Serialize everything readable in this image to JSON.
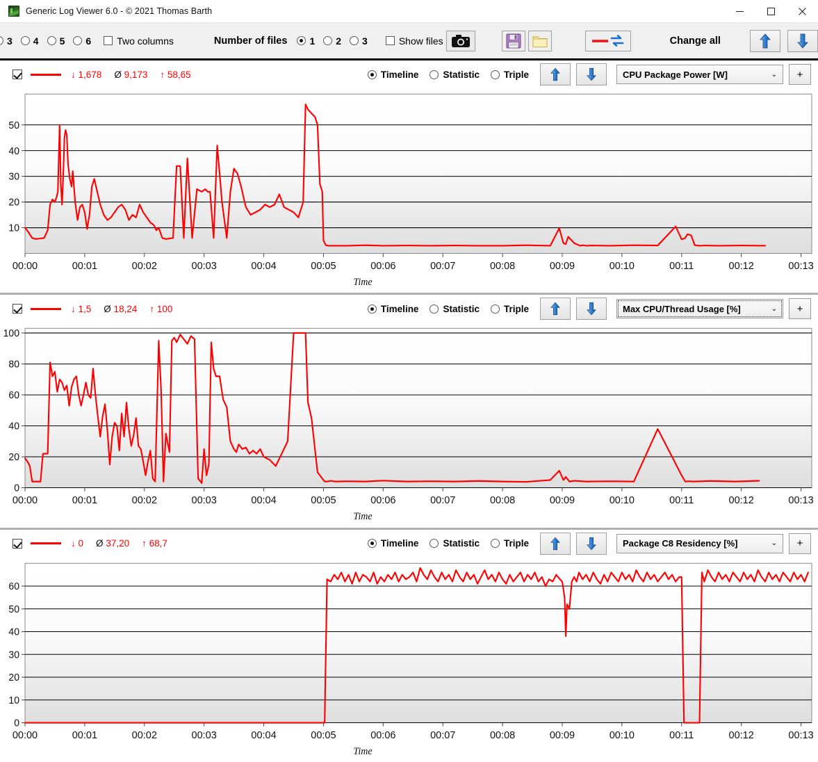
{
  "window": {
    "title": "Generic Log Viewer 6.0 - © 2021 Thomas Barth",
    "app_icon": "app-icon",
    "minimize": "–",
    "maximize": "□",
    "close": "✕"
  },
  "toolbar": {
    "columns_radios": [
      {
        "label": "3",
        "selected": false
      },
      {
        "label": "4",
        "selected": false
      },
      {
        "label": "5",
        "selected": false
      },
      {
        "label": "6",
        "selected": false
      }
    ],
    "two_columns_label": "Two columns",
    "two_columns_checked": false,
    "number_of_files_label": "Number of files",
    "file_radios": [
      {
        "label": "1",
        "selected": true
      },
      {
        "label": "2",
        "selected": false
      },
      {
        "label": "3",
        "selected": false
      }
    ],
    "show_files_label": "Show files",
    "show_files_checked": false,
    "camera_button": "camera-icon",
    "save_button": "floppy-disk-icon",
    "open_button": "folder-icon",
    "swap_button": "line-swap-icon",
    "change_all_label": "Change all",
    "move_up_button": "arrow-up-icon",
    "move_down_button": "arrow-down-icon"
  },
  "common": {
    "mode_timeline": "Timeline",
    "mode_statistic": "Statistic",
    "mode_triple": "Triple",
    "min_symbol": "↓",
    "avg_symbol": "Ø",
    "max_symbol": "↑",
    "plus_label": "+",
    "caret": "⌄",
    "xlabel": "Time"
  },
  "charts": [
    {
      "enabled": true,
      "min": "1,678",
      "avg": "9,173",
      "max": "58,65",
      "mode": "Timeline",
      "metric": "CPU Package Power [W]",
      "focused": false
    },
    {
      "enabled": true,
      "min": "1,5",
      "avg": "18,24",
      "max": "100",
      "mode": "Timeline",
      "metric": "Max CPU/Thread Usage [%]",
      "focused": true
    },
    {
      "enabled": true,
      "min": "0",
      "avg": "37,20",
      "max": "68,7",
      "mode": "Timeline",
      "metric": "Package C8 Residency [%]",
      "focused": false
    }
  ],
  "chart_data": [
    {
      "type": "line",
      "title": "CPU Package Power [W]",
      "xlabel": "Time",
      "ylabel": "",
      "series_color": "#ff0000",
      "grid": true,
      "legend": "none",
      "xlim": [
        0,
        13.18
      ],
      "ylim": [
        0,
        62
      ],
      "xticks": [
        "00:00",
        "00:01",
        "00:02",
        "00:03",
        "00:04",
        "00:05",
        "00:06",
        "00:07",
        "00:08",
        "00:09",
        "00:10",
        "00:11",
        "00:12",
        "00:13"
      ],
      "yticks": [
        10,
        20,
        30,
        40,
        50
      ],
      "x": [
        0,
        0.05,
        0.12,
        0.18,
        0.25,
        0.32,
        0.38,
        0.42,
        0.46,
        0.5,
        0.53,
        0.55,
        0.58,
        0.6,
        0.62,
        0.64,
        0.66,
        0.68,
        0.7,
        0.72,
        0.75,
        0.78,
        0.8,
        0.84,
        0.88,
        0.92,
        0.96,
        1.0,
        1.04,
        1.08,
        1.12,
        1.16,
        1.2,
        1.26,
        1.32,
        1.38,
        1.44,
        1.5,
        1.56,
        1.62,
        1.68,
        1.74,
        1.8,
        1.86,
        1.92,
        1.98,
        2.04,
        2.1,
        2.16,
        2.2,
        2.24,
        2.3,
        2.36,
        2.42,
        2.48,
        2.54,
        2.6,
        2.66,
        2.72,
        2.8,
        2.88,
        2.96,
        3.02,
        3.06,
        3.1,
        3.16,
        3.22,
        3.3,
        3.38,
        3.44,
        3.5,
        3.56,
        3.62,
        3.7,
        3.78,
        3.86,
        3.94,
        4.02,
        4.1,
        4.18,
        4.26,
        4.34,
        4.42,
        4.5,
        4.58,
        4.66,
        4.7,
        4.74,
        4.78,
        4.82,
        4.86,
        4.9,
        4.94,
        4.98,
        5.0,
        5.04,
        5.08,
        5.14,
        5.2,
        5.4,
        5.7,
        6.0,
        6.4,
        6.8,
        7.2,
        7.6,
        8.0,
        8.4,
        8.8,
        8.95,
        9.02,
        9.06,
        9.1,
        9.2,
        9.3,
        9.35,
        9.4,
        9.5,
        9.8,
        10.2,
        10.6,
        10.9,
        11.0,
        11.05,
        11.1,
        11.16,
        11.22,
        11.3,
        11.4,
        11.6,
        12.0,
        12.4,
        12.8,
        13.18
      ],
      "y": [
        10,
        8.5,
        6,
        5.6,
        5.8,
        6,
        9,
        19,
        21,
        20,
        22,
        24,
        50,
        27,
        19,
        30,
        45,
        48,
        46,
        35,
        29,
        26,
        32,
        20,
        13,
        18,
        19,
        16,
        9.5,
        15,
        26,
        29,
        25,
        19,
        15,
        13,
        14,
        16,
        18,
        19,
        17,
        13,
        15,
        14,
        19,
        16,
        14,
        12,
        11,
        9,
        10,
        6,
        5.6,
        5.8,
        6,
        34,
        34,
        6,
        37,
        6,
        25,
        24,
        25,
        24,
        24,
        6,
        42,
        20,
        6,
        24,
        33,
        31,
        26,
        18,
        15,
        16,
        17,
        19,
        18,
        19,
        23,
        18,
        17,
        16,
        14,
        20,
        58,
        56,
        55,
        54,
        53,
        50,
        27,
        24,
        5,
        3.2,
        3,
        3,
        3,
        3,
        3.2,
        3,
        3.1,
        3,
        3.1,
        3,
        3,
        3.2,
        3,
        9.8,
        4,
        3.6,
        6.5,
        4,
        3,
        3.2,
        3,
        3.1,
        3,
        3.2,
        3.1,
        10.5,
        5.5,
        5.8,
        7.5,
        7,
        3.2,
        3,
        3.1,
        3,
        3.1,
        3
      ]
    },
    {
      "type": "line",
      "title": "Max CPU/Thread Usage [%]",
      "xlabel": "Time",
      "ylabel": "",
      "series_color": "#ff0000",
      "grid": true,
      "legend": "none",
      "xlim": [
        0,
        13.18
      ],
      "ylim": [
        0,
        103
      ],
      "xticks": [
        "00:00",
        "00:01",
        "00:02",
        "00:03",
        "00:04",
        "00:05",
        "00:06",
        "00:07",
        "00:08",
        "00:09",
        "00:10",
        "00:11",
        "00:12",
        "00:13"
      ],
      "yticks": [
        0,
        20,
        40,
        60,
        80,
        100
      ],
      "x": [
        0,
        0.04,
        0.08,
        0.12,
        0.16,
        0.2,
        0.26,
        0.3,
        0.34,
        0.38,
        0.42,
        0.46,
        0.5,
        0.54,
        0.58,
        0.62,
        0.66,
        0.7,
        0.74,
        0.78,
        0.82,
        0.86,
        0.9,
        0.94,
        0.98,
        1.02,
        1.06,
        1.1,
        1.14,
        1.18,
        1.22,
        1.26,
        1.3,
        1.34,
        1.38,
        1.42,
        1.46,
        1.5,
        1.54,
        1.58,
        1.62,
        1.66,
        1.7,
        1.74,
        1.78,
        1.82,
        1.86,
        1.9,
        1.94,
        1.98,
        2.02,
        2.06,
        2.1,
        2.14,
        2.18,
        2.24,
        2.28,
        2.32,
        2.36,
        2.42,
        2.46,
        2.5,
        2.54,
        2.6,
        2.66,
        2.72,
        2.78,
        2.84,
        2.9,
        2.96,
        3.0,
        3.04,
        3.08,
        3.12,
        3.16,
        3.2,
        3.26,
        3.32,
        3.38,
        3.44,
        3.5,
        3.54,
        3.58,
        3.64,
        3.7,
        3.76,
        3.82,
        3.88,
        3.94,
        4.0,
        4.1,
        4.2,
        4.3,
        4.4,
        4.5,
        4.6,
        4.66,
        4.7,
        4.74,
        4.8,
        4.9,
        5.0,
        5.02,
        5.06,
        5.12,
        5.2,
        5.4,
        5.7,
        6.0,
        6.4,
        6.8,
        7.2,
        7.6,
        8.0,
        8.4,
        8.8,
        8.95,
        9.02,
        9.06,
        9.12,
        9.2,
        9.4,
        9.8,
        10.2,
        10.6,
        11.0,
        11.06,
        11.12,
        11.2,
        11.5,
        11.9,
        12.3,
        12.7,
        13.18
      ],
      "y": [
        19,
        17,
        14,
        4,
        4,
        4,
        4,
        22,
        22,
        22,
        81,
        72,
        75,
        62,
        70,
        68,
        63,
        66,
        53,
        65,
        70,
        72,
        60,
        53,
        60,
        68,
        60,
        58,
        77,
        60,
        46,
        33,
        46,
        54,
        37,
        15,
        33,
        42,
        40,
        24,
        48,
        33,
        55,
        38,
        27,
        34,
        45,
        27,
        25,
        17,
        8,
        17,
        24,
        6,
        4,
        95,
        63,
        4,
        35,
        23,
        95,
        97,
        94,
        99,
        96,
        93,
        98,
        96,
        6,
        3,
        25,
        8,
        15,
        94,
        77,
        72,
        72,
        57,
        52,
        30,
        25,
        23,
        28,
        25,
        26,
        22,
        24,
        22,
        25,
        20,
        18,
        14,
        22,
        30,
        100,
        100,
        100,
        100,
        55,
        45,
        10,
        5,
        4,
        4,
        4.5,
        4,
        4.2,
        4,
        4.6,
        4,
        4.2,
        4,
        4.4,
        4,
        3.8,
        5,
        11,
        5,
        7,
        4,
        4.5,
        4,
        4.2,
        4,
        38,
        8,
        4,
        4.2,
        4,
        4.4,
        4,
        4.5
      ]
    },
    {
      "type": "line",
      "title": "Package C8 Residency [%]",
      "xlabel": "Time",
      "ylabel": "",
      "series_color": "#ff0000",
      "grid": true,
      "legend": "none",
      "xlim": [
        0,
        13.18
      ],
      "ylim": [
        0,
        70
      ],
      "xticks": [
        "00:00",
        "00:01",
        "00:02",
        "00:03",
        "00:04",
        "00:05",
        "00:06",
        "00:07",
        "00:08",
        "00:09",
        "00:10",
        "00:11",
        "00:12",
        "00:13"
      ],
      "yticks": [
        0,
        10,
        20,
        30,
        40,
        50,
        60
      ],
      "x": [
        0,
        1,
        2,
        3,
        4,
        5.02,
        5.06,
        5.12,
        5.18,
        5.24,
        5.3,
        5.36,
        5.42,
        5.48,
        5.54,
        5.6,
        5.66,
        5.72,
        5.78,
        5.84,
        5.9,
        5.96,
        6.02,
        6.08,
        6.14,
        6.2,
        6.26,
        6.32,
        6.38,
        6.44,
        6.5,
        6.56,
        6.62,
        6.68,
        6.74,
        6.8,
        6.86,
        6.92,
        6.98,
        7.04,
        7.1,
        7.16,
        7.22,
        7.28,
        7.34,
        7.4,
        7.46,
        7.52,
        7.58,
        7.64,
        7.7,
        7.76,
        7.82,
        7.88,
        7.94,
        8.0,
        8.06,
        8.12,
        8.18,
        8.24,
        8.3,
        8.36,
        8.42,
        8.48,
        8.54,
        8.6,
        8.66,
        8.72,
        8.78,
        8.84,
        8.9,
        8.96,
        9.0,
        9.04,
        9.06,
        9.08,
        9.12,
        9.16,
        9.2,
        9.24,
        9.28,
        9.34,
        9.4,
        9.46,
        9.52,
        9.58,
        9.64,
        9.7,
        9.76,
        9.82,
        9.88,
        9.94,
        10.0,
        10.06,
        10.12,
        10.18,
        10.24,
        10.3,
        10.36,
        10.42,
        10.48,
        10.54,
        10.6,
        10.66,
        10.72,
        10.78,
        10.84,
        10.9,
        10.96,
        11.0,
        11.04,
        11.08,
        11.3,
        11.34,
        11.38,
        11.44,
        11.5,
        11.56,
        11.62,
        11.68,
        11.74,
        11.8,
        11.86,
        11.92,
        11.98,
        12.04,
        12.1,
        12.16,
        12.22,
        12.28,
        12.34,
        12.4,
        12.46,
        12.52,
        12.58,
        12.64,
        12.7,
        12.76,
        12.82,
        12.88,
        12.94,
        13.0,
        13.06,
        13.12,
        13.18
      ],
      "y": [
        0,
        0,
        0,
        0,
        0,
        0,
        63,
        62,
        65,
        63,
        66,
        62,
        65,
        61,
        66,
        62,
        65,
        64,
        62,
        66,
        61,
        64,
        62,
        65,
        63,
        66,
        62,
        65,
        63,
        64,
        66,
        62,
        68,
        65,
        63,
        67,
        64,
        62,
        66,
        63,
        65,
        62,
        67,
        64,
        62,
        66,
        63,
        65,
        61,
        64,
        67,
        63,
        65,
        62,
        66,
        63,
        61,
        65,
        62,
        64,
        66,
        62,
        65,
        63,
        66,
        62,
        64,
        60,
        63,
        62,
        65,
        63,
        62,
        55,
        38,
        52,
        50,
        62,
        64,
        62,
        66,
        63,
        65,
        62,
        66,
        63,
        61,
        65,
        62,
        66,
        64,
        62,
        66,
        63,
        65,
        62,
        67,
        64,
        62,
        66,
        63,
        65,
        62,
        64,
        66,
        63,
        65,
        62,
        64,
        64,
        0,
        0,
        0,
        66,
        62,
        67,
        64,
        62,
        66,
        63,
        65,
        62,
        66,
        64,
        62,
        66,
        63,
        65,
        62,
        67,
        64,
        62,
        66,
        63,
        65,
        62,
        66,
        64,
        62,
        66,
        63,
        65,
        62,
        66
      ]
    }
  ]
}
